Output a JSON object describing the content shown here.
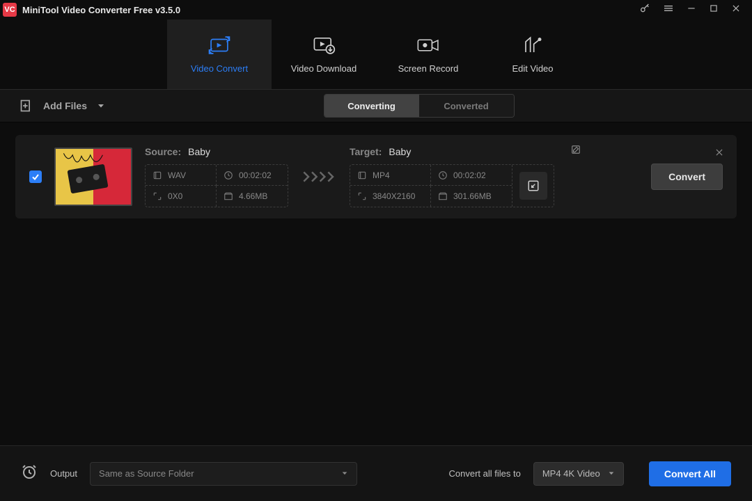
{
  "title": "MiniTool Video Converter Free v3.5.0",
  "main_tabs": {
    "convert": "Video Convert",
    "download": "Video Download",
    "record": "Screen Record",
    "edit": "Edit Video"
  },
  "toolbar": {
    "add_files": "Add Files",
    "seg": {
      "converting": "Converting",
      "converted": "Converted"
    }
  },
  "file": {
    "source": {
      "label": "Source:",
      "name": "Baby",
      "format": "WAV",
      "resolution": "0X0",
      "duration": "00:02:02",
      "size": "4.66MB"
    },
    "target": {
      "label": "Target:",
      "name": "Baby",
      "format": "MP4",
      "resolution": "3840X2160",
      "duration": "00:02:02",
      "size": "301.66MB"
    },
    "convert_btn": "Convert"
  },
  "bottom": {
    "output_label": "Output",
    "output_value": "Same as Source Folder",
    "convert_all_label": "Convert all files to",
    "preset": "MP4 4K Video",
    "convert_all_btn": "Convert All"
  }
}
